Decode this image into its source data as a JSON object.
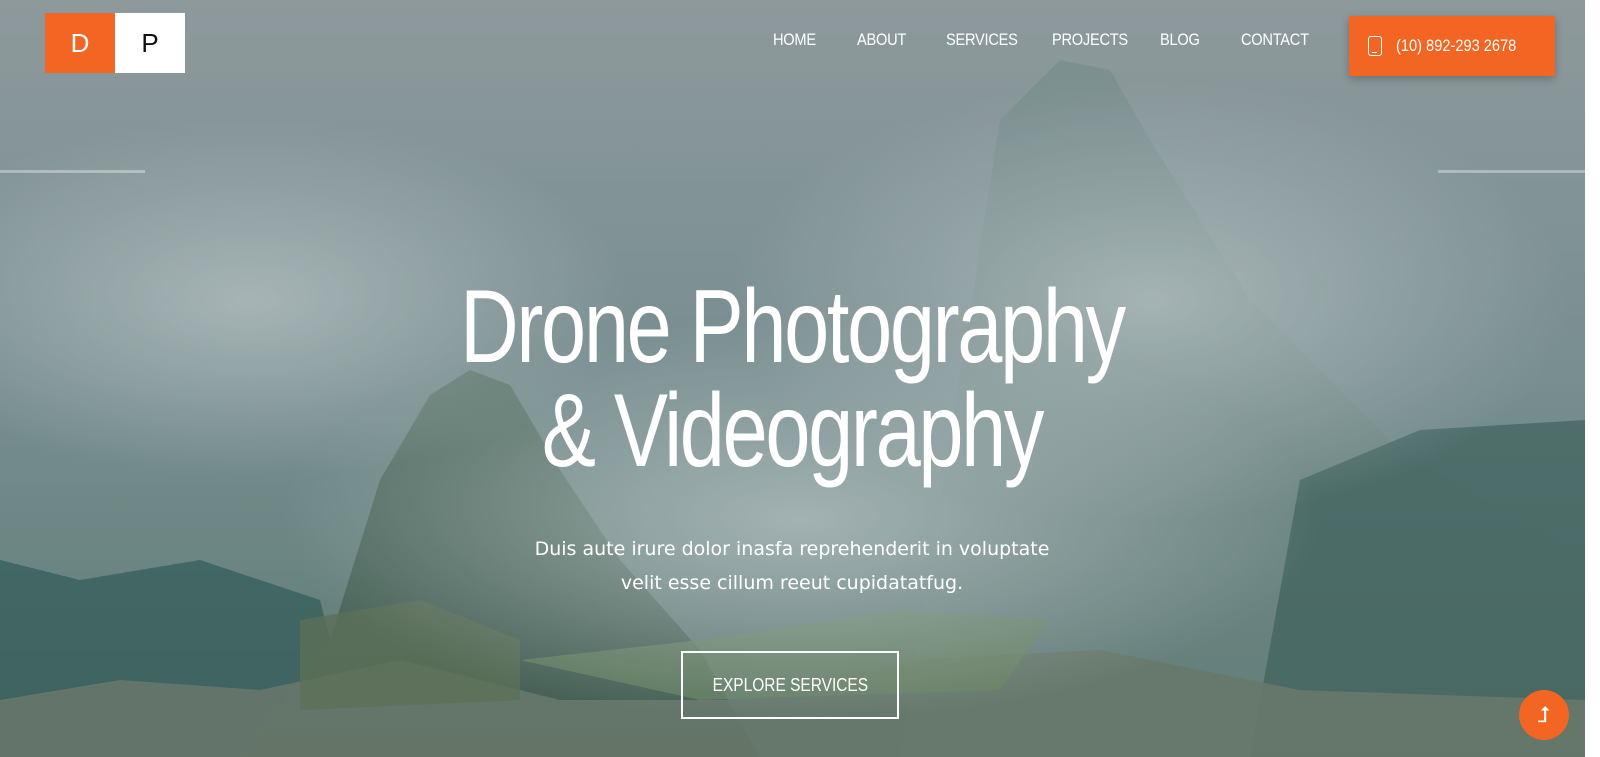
{
  "brand": {
    "logo_letter_1": "D",
    "logo_letter_2": "P",
    "accent_color": "#f26522"
  },
  "nav": {
    "items": [
      {
        "label": "HOME"
      },
      {
        "label": "ABOUT"
      },
      {
        "label": "SERVICES"
      },
      {
        "label": "PROJECTS"
      },
      {
        "label": "BLOG"
      },
      {
        "label": "CONTACT"
      }
    ]
  },
  "phone_button": {
    "label": "(10) 892-293 2678",
    "icon": "phone-icon"
  },
  "hero": {
    "headline_line_1": "Drone Photography",
    "headline_line_2": "& Videography",
    "subtext_line_1": "Duis aute irure dolor inasfa reprehenderit in voluptate",
    "subtext_line_2": "velit esse cillum reeut cupidatatfug.",
    "cta_label": "EXPLORE SERVICES"
  },
  "scroll_to_top": {
    "icon": "arrow-up-icon",
    "glyph": "⮥"
  }
}
